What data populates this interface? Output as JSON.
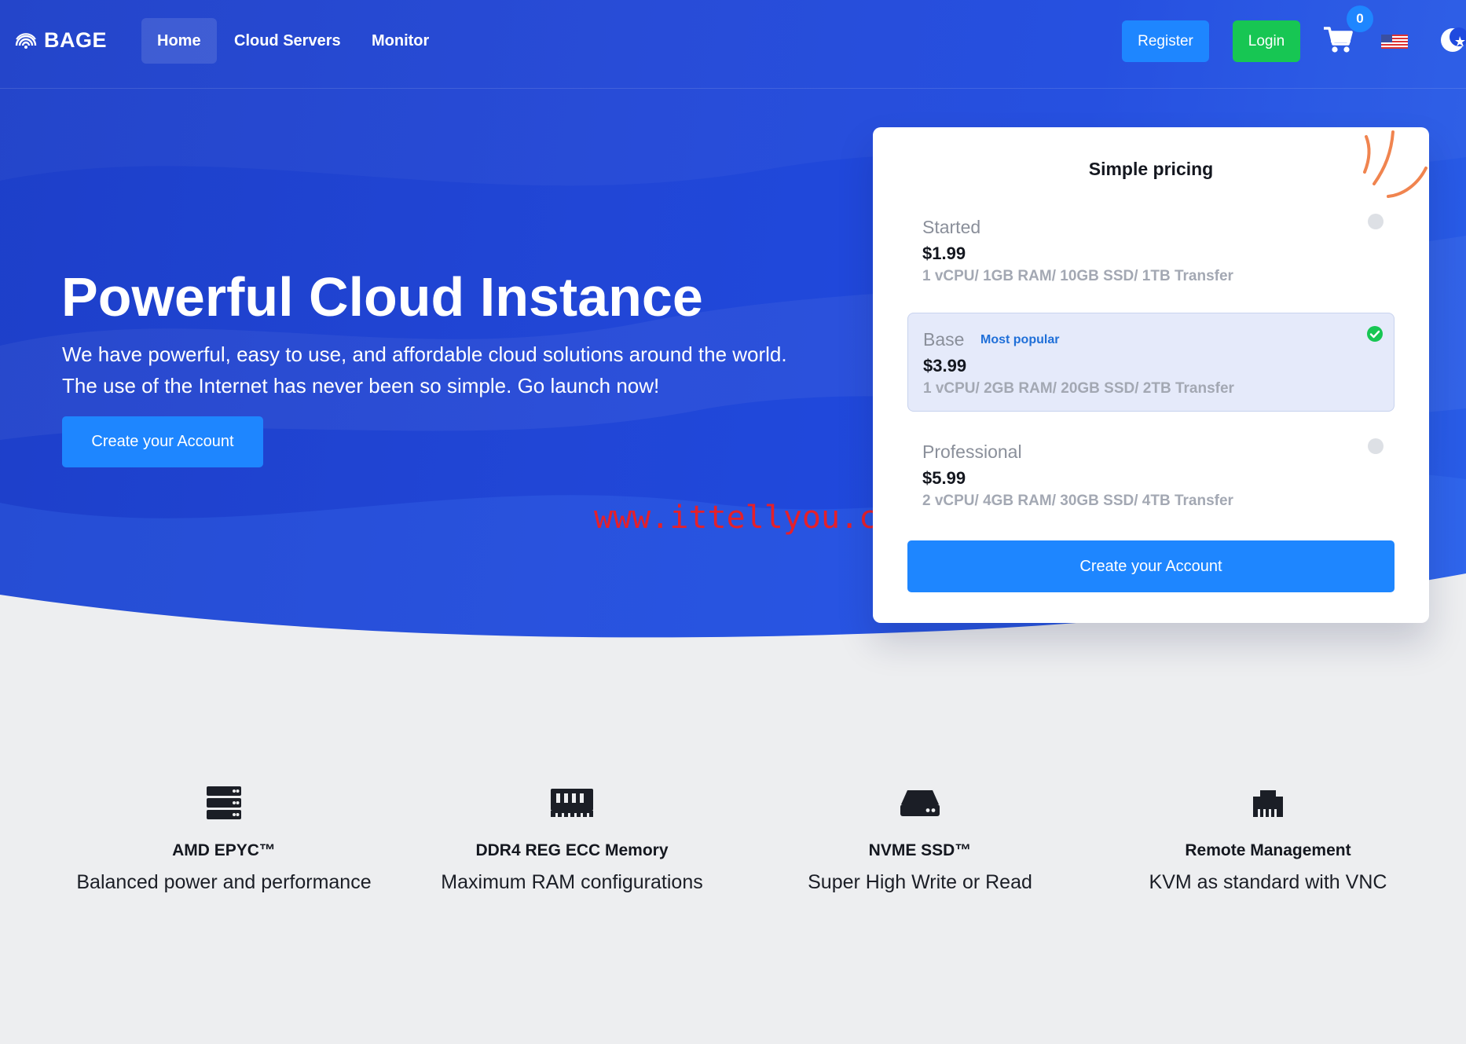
{
  "brand": {
    "name": "BAGE"
  },
  "nav": {
    "items": [
      {
        "label": "Home",
        "active": true
      },
      {
        "label": "Cloud Servers",
        "active": false
      },
      {
        "label": "Monitor",
        "active": false
      }
    ],
    "register_label": "Register",
    "login_label": "Login",
    "cart_count": "0",
    "cart_icon": "cart-icon",
    "language_icon": "us-flag-icon",
    "theme_icon": "moon-icon"
  },
  "hero": {
    "title": "Powerful Cloud Instance",
    "subtitle_line1": "We have powerful, easy to use, and affordable cloud solutions around the world.",
    "subtitle_line2": "The use of the Internet has never been so simple. Go launch now!",
    "cta_label": "Create your Account",
    "watermark": "www.ittellyou.com"
  },
  "pricing": {
    "title": "Simple pricing",
    "plans": [
      {
        "name": "Started",
        "price": "$1.99",
        "spec": "1 vCPU/ 1GB RAM/ 10GB SSD/ 1TB Transfer",
        "selected": false
      },
      {
        "name": "Base",
        "badge": "Most popular",
        "price": "$3.99",
        "spec": "1 vCPU/ 2GB RAM/ 20GB SSD/ 2TB Transfer",
        "selected": true
      },
      {
        "name": "Professional",
        "price": "$5.99",
        "spec": "2 vCPU/ 4GB RAM/ 30GB SSD/ 4TB Transfer",
        "selected": false
      }
    ],
    "cta_label": "Create your Account"
  },
  "features": [
    {
      "icon": "server-icon",
      "title": "AMD EPYC™",
      "desc": "Balanced power and performance"
    },
    {
      "icon": "memory-icon",
      "title": "DDR4 REG ECC Memory",
      "desc": "Maximum RAM configurations"
    },
    {
      "icon": "hard-drive-icon",
      "title": "NVME SSD™",
      "desc": "Super High Write or Read"
    },
    {
      "icon": "ethernet-icon",
      "title": "Remote Management",
      "desc": "KVM as standard with VNC"
    }
  ],
  "colors": {
    "hero_blue": "#1f45d4",
    "primary_button": "#1e86ff",
    "login_green": "#17c653",
    "watermark_red": "#e5202a",
    "page_bg": "#edeef0"
  }
}
